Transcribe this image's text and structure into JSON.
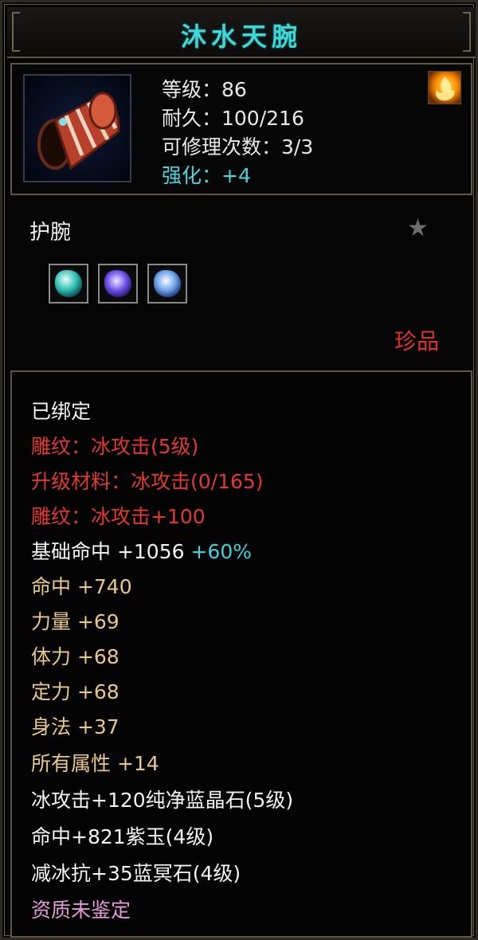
{
  "item": {
    "name": "沐水天腕",
    "level_label": "等级：86",
    "durability_label": "耐久：100/216",
    "repair_label": "可修理次数：3/3",
    "enhance_label": "强化：",
    "enhance_value": "+4",
    "type": "护腕",
    "rarity": "珍品"
  },
  "icons": {
    "item_icon": "bracer-icon",
    "fire_icon": "fire-icon",
    "star_icon": "star-icon",
    "gems": [
      "green-gem-icon",
      "purple-gem-icon",
      "blue-gem-icon"
    ]
  },
  "attributes": {
    "bound": "已绑定",
    "engrave1": "雕纹：冰攻击(5级)",
    "upgrade_material": "升级材料：冰攻击(0/165)",
    "engrave2": "雕纹：冰攻击+100",
    "base_hit": "基础命中   +1056",
    "base_hit_pct": "+60%",
    "hit": "命中  +740",
    "strength": "力量  +69",
    "stamina": "体力  +68",
    "focus": "定力  +68",
    "agility": "身法  +37",
    "all_attr": "所有属性   +14",
    "gem1": "冰攻击+120纯净蓝晶石(5级)",
    "gem2": "命中+821紫玉(4级)",
    "gem3": "减冰抗+35蓝冥石(4级)",
    "aptitude": "资质未鉴定"
  },
  "colors": {
    "title": "#3fd8d8",
    "rarity": "#e0342a",
    "engrave": "#e03a30",
    "stat": "#e8c78a",
    "aptitude": "#e59bd8"
  }
}
